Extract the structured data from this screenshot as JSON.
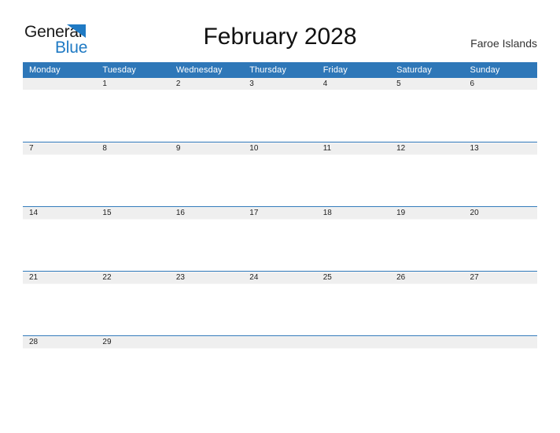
{
  "brand": {
    "name_part1": "General",
    "name_part2": "Blue",
    "flag_icon": "blue-flag-triangle-icon",
    "accent_color": "#1f7ac4"
  },
  "header": {
    "title": "February 2028",
    "region": "Faroe Islands"
  },
  "colors": {
    "header_blue": "#2e77b8",
    "row_band_gray": "#efefef",
    "title_text": "#111111",
    "daynum_text": "#222222"
  },
  "calendar": {
    "month": "February",
    "year": "2028",
    "weekday_headers": [
      "Monday",
      "Tuesday",
      "Wednesday",
      "Thursday",
      "Friday",
      "Saturday",
      "Sunday"
    ],
    "weeks": [
      [
        "",
        "1",
        "2",
        "3",
        "4",
        "5",
        "6"
      ],
      [
        "7",
        "8",
        "9",
        "10",
        "11",
        "12",
        "13"
      ],
      [
        "14",
        "15",
        "16",
        "17",
        "18",
        "19",
        "20"
      ],
      [
        "21",
        "22",
        "23",
        "24",
        "25",
        "26",
        "27"
      ],
      [
        "28",
        "29",
        "",
        "",
        "",
        "",
        ""
      ]
    ]
  }
}
